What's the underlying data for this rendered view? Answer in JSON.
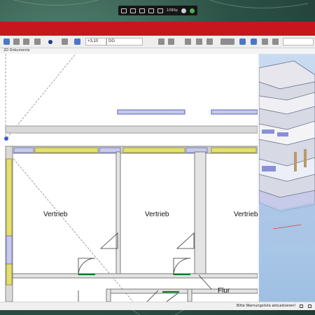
{
  "capture_bar": {
    "resolution": "1080p"
  },
  "toolbar": {
    "elevation_value": "+3,10",
    "storey_value": "DG"
  },
  "tabs": {
    "active_tab": "2D Dokumente"
  },
  "plan": {
    "rooms": [
      {
        "label": "Vertrieb"
      },
      {
        "label": "Vertrieb"
      },
      {
        "label": "Vertrieb"
      },
      {
        "label": "Flur"
      }
    ]
  },
  "statusbar": {
    "message": "Bitte Warnungsliste aktualisieren!"
  },
  "colors": {
    "titlebar": "#c8161d",
    "window_fill": "#e5e06c",
    "door_line": "#0f7a23",
    "wall": "#9a9a9a"
  },
  "icons": [
    "record-icon",
    "camera-icon",
    "screen-icon",
    "mic-icon",
    "pause-icon",
    "settings-icon",
    "check-icon",
    "window-tool-icon",
    "zoom-in-icon",
    "zoom-out-icon",
    "pan-icon",
    "layer-icon",
    "grid-icon"
  ]
}
